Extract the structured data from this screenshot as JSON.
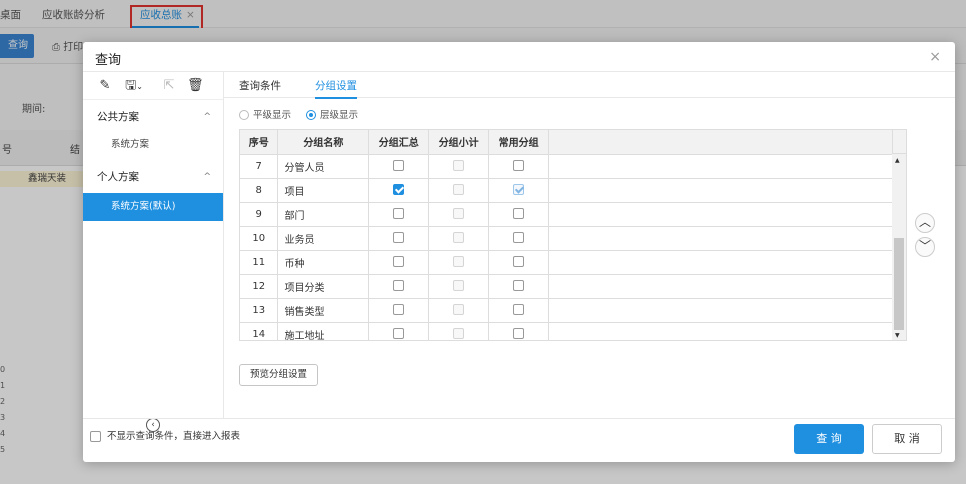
{
  "background": {
    "tabs": [
      "桌面",
      "应收账龄分析",
      "应收总账"
    ],
    "active_tab_close": "×",
    "query_button": "查询",
    "print_label": "打印",
    "period_label": "期间:",
    "grid_header_col1": "号",
    "grid_header_col2": "结",
    "first_row_text": "鑫瑞天装",
    "row_numbers": [
      "0",
      "1",
      "2",
      "3",
      "4",
      "5"
    ]
  },
  "dialog": {
    "title": "查询",
    "close": "×",
    "left": {
      "public_group": "公共方案",
      "public_schemes": [
        "系统方案"
      ],
      "personal_group": "个人方案",
      "personal_schemes": [
        "系统方案(默认)"
      ]
    },
    "tabs": [
      "查询条件",
      "分组设置"
    ],
    "active_tab": "分组设置",
    "display_modes": [
      "平级显示",
      "层级显示"
    ],
    "selected_mode": "层级显示",
    "grid": {
      "columns": [
        "序号",
        "分组名称",
        "分组汇总",
        "分组小计",
        "常用分组"
      ],
      "rows": [
        {
          "no": "7",
          "name": "分管人员",
          "summary": false,
          "subtotal": false,
          "common": false
        },
        {
          "no": "8",
          "name": "项目",
          "summary": true,
          "subtotal": false,
          "common": true
        },
        {
          "no": "9",
          "name": "部门",
          "summary": false,
          "subtotal": false,
          "common": false
        },
        {
          "no": "10",
          "name": "业务员",
          "summary": false,
          "subtotal": false,
          "common": false
        },
        {
          "no": "11",
          "name": "币种",
          "summary": false,
          "subtotal": false,
          "common": false
        },
        {
          "no": "12",
          "name": "项目分类",
          "summary": false,
          "subtotal": false,
          "common": false
        },
        {
          "no": "13",
          "name": "销售类型",
          "summary": false,
          "subtotal": false,
          "common": false
        },
        {
          "no": "14",
          "name": "施工地址",
          "summary": false,
          "subtotal": false,
          "common": false
        }
      ]
    },
    "preview_button": "预览分组设置",
    "skip_conditions_label": "不显示查询条件，直接进入报表",
    "query_button": "查 询",
    "cancel_button": "取 消"
  },
  "colors": {
    "accent": "#1f8fe0",
    "highlight": "#e3332f"
  }
}
